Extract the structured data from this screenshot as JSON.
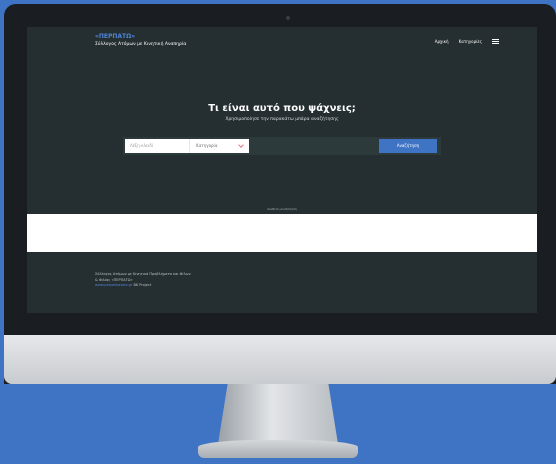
{
  "header": {
    "brand_name": "«ΠΕΡΠΑΤΩ»",
    "brand_subtitle": "Σύλλογος Ατόμων με Κινητική Αναπηρία",
    "nav": [
      {
        "label": "Αρχική"
      },
      {
        "label": "Κατηγορίες"
      }
    ]
  },
  "hero": {
    "title": "Τι είναι αυτό που ψάχνεις;",
    "subtitle": "Χρησιμοποίησε την παρακάτω μπάρα αναζήτησης"
  },
  "search": {
    "input_placeholder": "Λέξη-κλειδί",
    "category_selected": "Κατηγορία",
    "button_label": "Αναζήτηση"
  },
  "advanced_link": "σύνθετη αναζήτηση",
  "footer": {
    "line1": "Σύλλογος Ατόμων με Κινητικά Προβλήματα και Φίλων",
    "line2": "& Φιλίας «ΠΕΡΠΑΤΩ»",
    "link_text": "www.perpatoaxaia.gr",
    "line3_suffix": " BK Project"
  },
  "colors": {
    "background": "#3f74c4",
    "screen": "#252f31",
    "accent": "#3f74c4"
  }
}
